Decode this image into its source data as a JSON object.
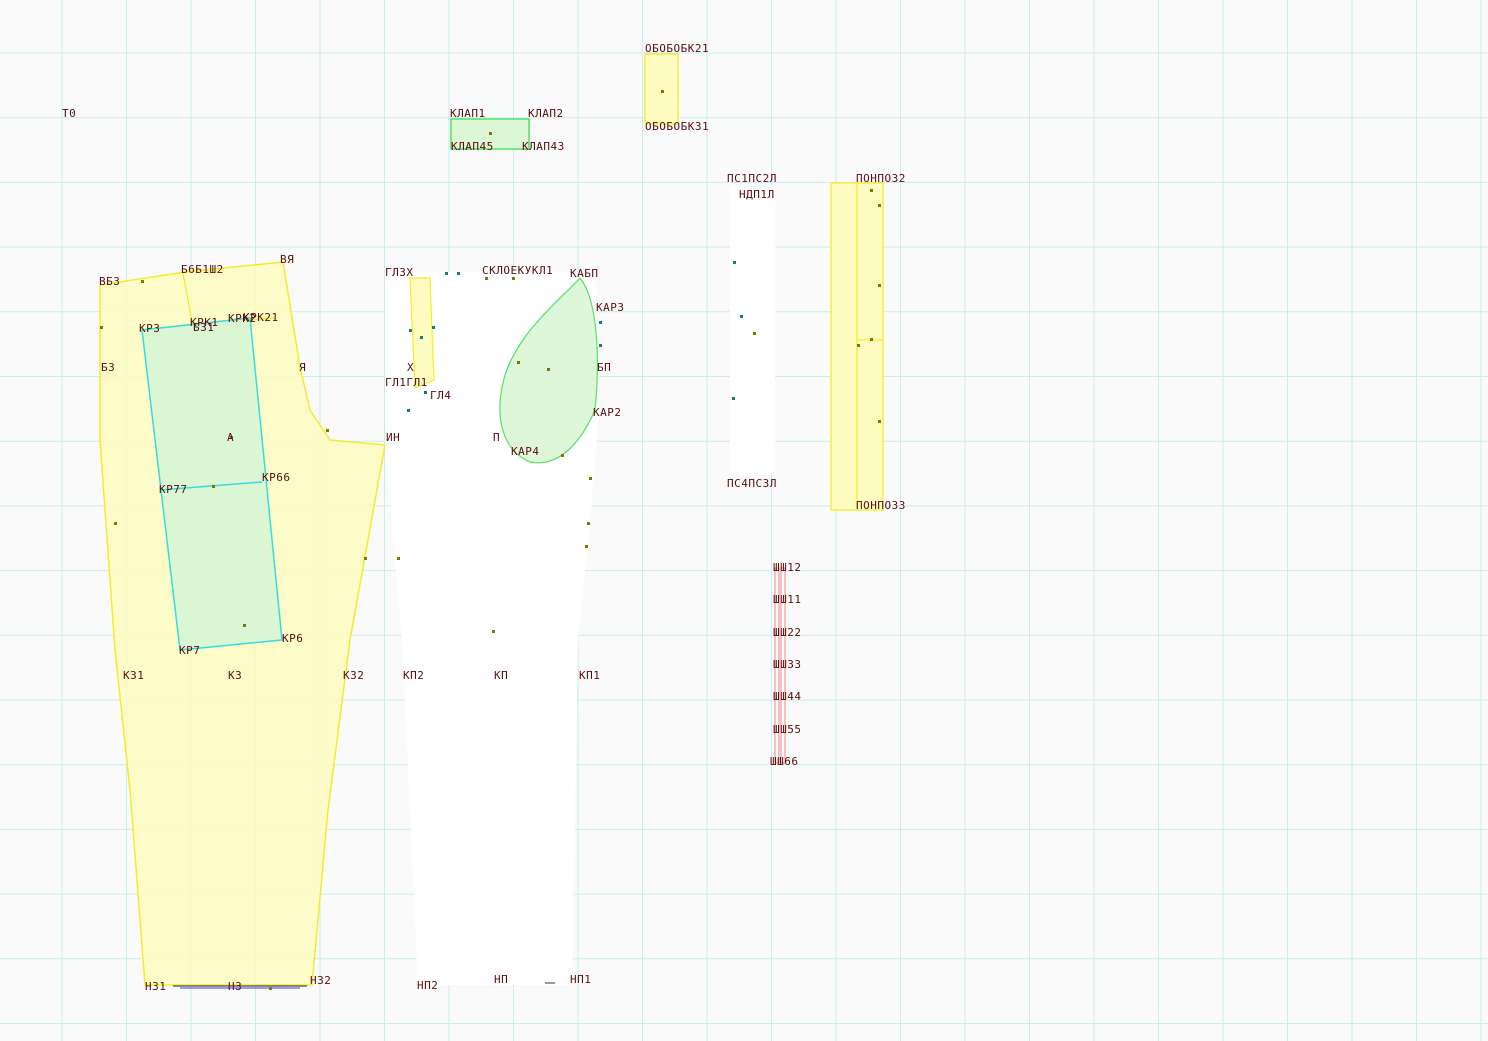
{
  "colors": {
    "grid": "#c9ecec",
    "yellow_fill": "#fdfbbf",
    "yellow_stroke": "#f1ee29",
    "green_fill": "#dcf7d6",
    "green_stroke": "#55e06a",
    "cyan_stroke": "#38dbe0",
    "red_stroke": "#f08a8a",
    "label": "#5a0d0d",
    "point": "#7a7a00"
  },
  "labels": [
    {
      "id": "t0",
      "text": "Т0"
    },
    {
      "id": "bb3",
      "text": "ВБ3"
    },
    {
      "id": "b6b",
      "text": "Б6Б1Ш2"
    },
    {
      "id": "ba",
      "text": "ВЯ"
    },
    {
      "id": "kp3",
      "text": "КР3"
    },
    {
      "id": "kpk",
      "text": "КРК1"
    },
    {
      "id": "kpkk",
      "text": "КРК2"
    },
    {
      "id": "b3b",
      "text": "Б31"
    },
    {
      "id": "kpk2",
      "text": "КРК21"
    },
    {
      "id": "b3",
      "text": "Б3"
    },
    {
      "id": "ya",
      "text": "Я"
    },
    {
      "id": "a",
      "text": "А"
    },
    {
      "id": "kp77",
      "text": "КР77"
    },
    {
      "id": "kp66",
      "text": "КР66"
    },
    {
      "id": "kp7",
      "text": "КР7"
    },
    {
      "id": "kp6",
      "text": "КР6"
    },
    {
      "id": "k31",
      "text": "К31"
    },
    {
      "id": "k3",
      "text": "К3"
    },
    {
      "id": "k32",
      "text": "К32"
    },
    {
      "id": "h31",
      "text": "Н31"
    },
    {
      "id": "h3",
      "text": "Н3"
    },
    {
      "id": "h32",
      "text": "Н32"
    },
    {
      "id": "gl3",
      "text": "ГЛ3Х"
    },
    {
      "id": "gl1",
      "text": "ГЛ1ГЛ1"
    },
    {
      "id": "gl4",
      "text": "ГЛ4"
    },
    {
      "id": "x",
      "text": "Х"
    },
    {
      "id": "in",
      "text": "ИН"
    },
    {
      "id": "sklo",
      "text": "СКЛОЕКУКЛ1"
    },
    {
      "id": "kabp",
      "text": "КАБП"
    },
    {
      "id": "kap3",
      "text": "КАР3"
    },
    {
      "id": "bp",
      "text": "БП"
    },
    {
      "id": "kap2",
      "text": "КАР2"
    },
    {
      "id": "p",
      "text": "П"
    },
    {
      "id": "kap4",
      "text": "КАР4"
    },
    {
      "id": "kp2",
      "text": "КП2"
    },
    {
      "id": "kp",
      "text": "КП"
    },
    {
      "id": "kp1",
      "text": "КП1"
    },
    {
      "id": "hp2",
      "text": "НП2"
    },
    {
      "id": "hp",
      "text": "НП"
    },
    {
      "id": "hp1",
      "text": "НП1"
    },
    {
      "id": "klap1",
      "text": "КЛАП1"
    },
    {
      "id": "klap2",
      "text": "КЛАП2"
    },
    {
      "id": "klap5",
      "text": "КЛАП45"
    },
    {
      "id": "klap3",
      "text": "КЛАП43"
    },
    {
      "id": "obk21",
      "text": "ОБОБОБК21"
    },
    {
      "id": "obk31",
      "text": "ОБОБОБК31"
    },
    {
      "id": "ps1",
      "text": "ПС1ПС2Л"
    },
    {
      "id": "ndp",
      "text": "НДП1Л"
    },
    {
      "id": "ps4",
      "text": "ПС4ПС3Л"
    },
    {
      "id": "poi2",
      "text": "ПОНПОЗ2"
    },
    {
      "id": "poi3",
      "text": "ПОНПОЗ3"
    },
    {
      "id": "sh12",
      "text": "ШШ12"
    },
    {
      "id": "sh11",
      "text": "ШШ11"
    },
    {
      "id": "sh22",
      "text": "ШШ22"
    },
    {
      "id": "sh33",
      "text": "ШШ33"
    },
    {
      "id": "sh44",
      "text": "ШШ44"
    },
    {
      "id": "sh55",
      "text": "ШШ55"
    },
    {
      "id": "sh66",
      "text": "ШШ66"
    }
  ]
}
